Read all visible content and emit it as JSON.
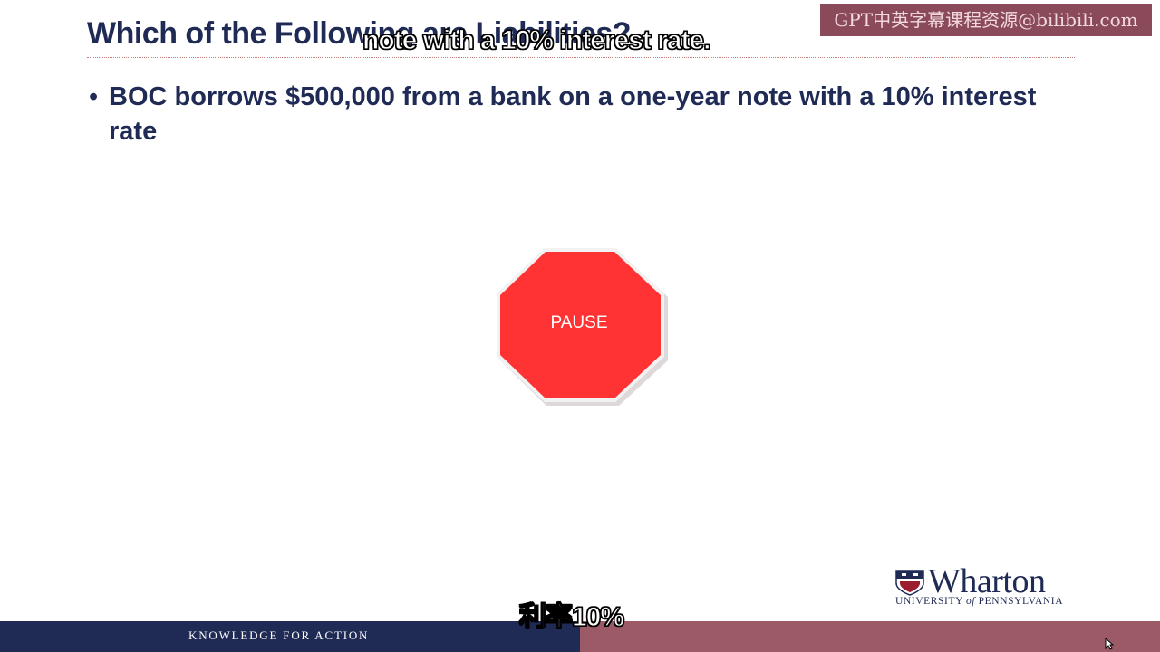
{
  "slide": {
    "title": "Which of the Following are Liabilities?",
    "bullets": [
      "BOC borrows $500,000 from a bank on a one-year note with a 10% interest rate"
    ],
    "bullet_glyph": "•",
    "stop_sign": {
      "label": "PAUSE",
      "fill": "#ff3333",
      "icon": "stop-sign-icon"
    }
  },
  "branding": {
    "name": "Wharton",
    "sub_prefix": "UNIVERSITY ",
    "sub_of": "of",
    "sub_suffix": " PENNSYLVANIA",
    "footer_text": "KNOWLEDGE FOR ACTION",
    "navy": "#1f2a55",
    "burgundy": "#9b5a66",
    "icon": "penn-shield-icon"
  },
  "overlay": {
    "watermark": "GPT中英字幕课程资源@bilibili.com",
    "subtitle_top": "note with a 10% interest rate.",
    "subtitle_bottom": "利率10%"
  },
  "cursor": {
    "icon": "mouse-pointer-icon"
  }
}
